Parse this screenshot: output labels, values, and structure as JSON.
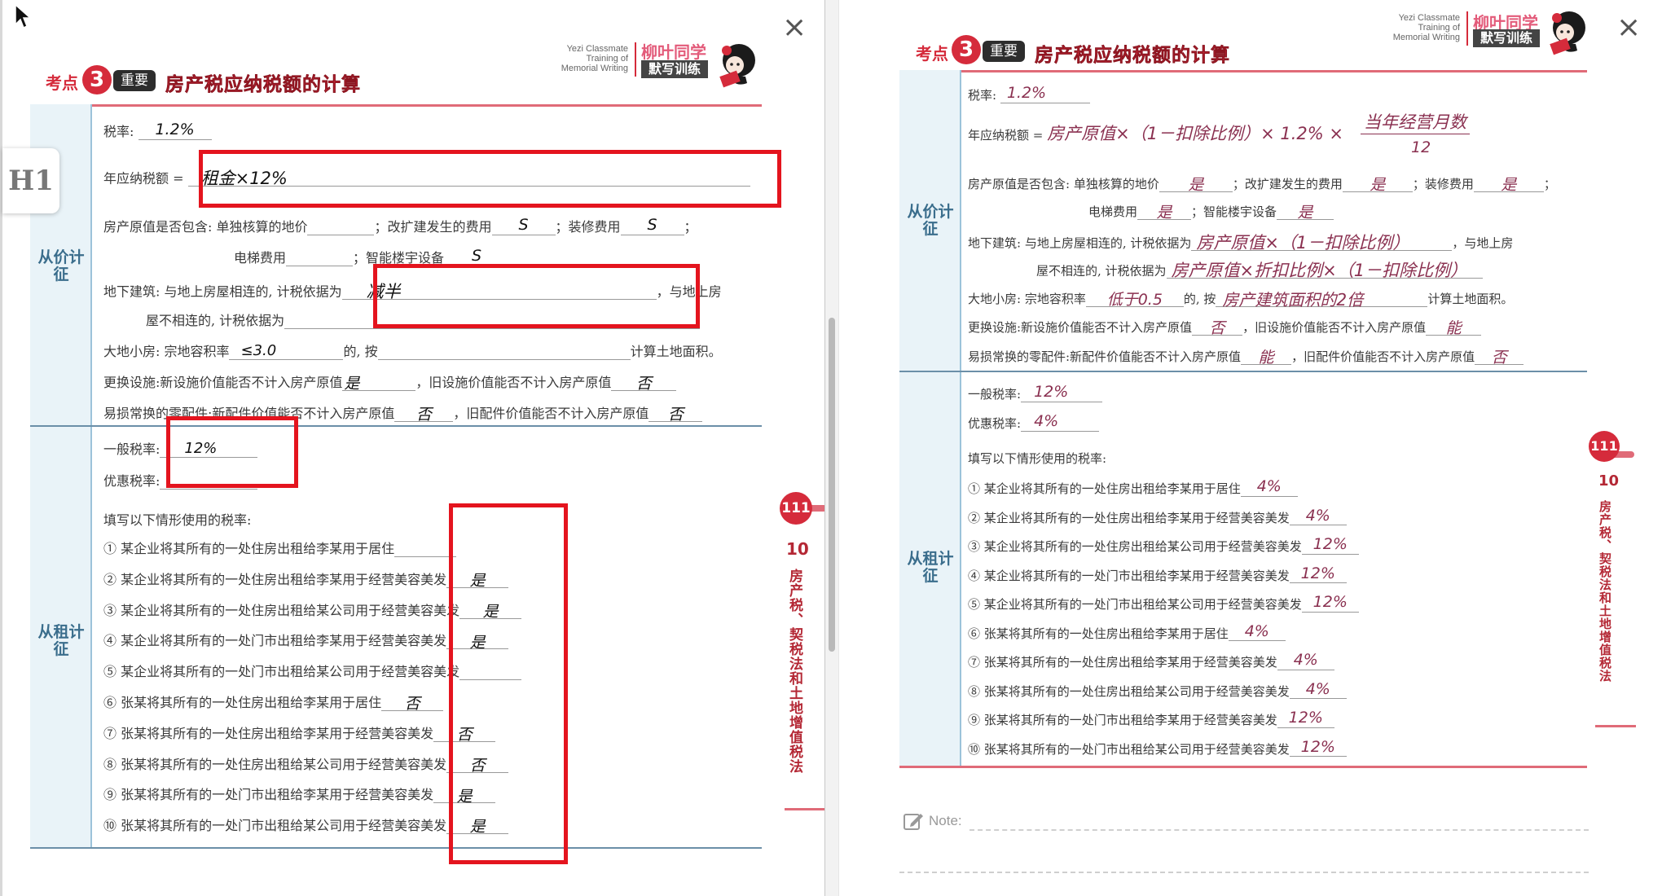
{
  "ui": {
    "close_glyph": "×",
    "h1_label": "H1",
    "note_label": "Note:"
  },
  "colors": {
    "accent_red": "#d52b3b",
    "annotation_box": "#e4141e",
    "sidebar_blue": "#e9f3f8"
  },
  "header": {
    "kaodian": "考点",
    "number": "3",
    "badge": "重要",
    "title": "房产税应纳税额的计算",
    "brand_en_1": "Yezi Classmate",
    "brand_en_2": "Training of",
    "brand_en_3": "Memorial Writing",
    "brand_zh": "柳叶同学",
    "brand_tag": "默写训练"
  },
  "side": {
    "by_value": "从价计征",
    "by_rent": "从租计征",
    "page_no": "111",
    "chapter_no": "10",
    "chapter_title": "房产税、契税法和土地增值税法"
  },
  "labels": {
    "rate": "税率:",
    "annual_tax": "年应纳税额 =",
    "orig_include": "房产原值是否包含: 单独核算的地价",
    "reno_cost": "；改扩建发生的费用",
    "deco_cost": "；装修费用",
    "elevator": "电梯费用",
    "smart": "；智能楼宇设备",
    "semicolon": "；",
    "underground": "地下建筑: 与地上房屋相连的, 计税依据为",
    "underground_2": "，与地上房",
    "underground_3": "屋不相连的, 计税依据为",
    "smallplot": "大地小房: 宗地容积率",
    "smallplot_2": "的, 按",
    "smallplot_3": "计算土地面积。",
    "replace": "更换设施:新设施价值能否不计入房产原值",
    "replace_2": "，旧设施价值能否不计入房产原值",
    "consumable": "易损常换的零配件:新配件价值能否不计入房产原值",
    "consumable_2": "，旧配件价值能否不计入房产原值",
    "general_rate": "一般税率:",
    "pref_rate": "优惠税率:",
    "fill_prompt": "填写以下情形使用的税率:",
    "cases": [
      "① 某企业将其所有的一处住房出租给李某用于居住",
      "② 某企业将其所有的一处住房出租给李某用于经营美容美发",
      "③ 某企业将其所有的一处住房出租给某公司用于经营美容美发",
      "④ 某企业将其所有的一处门市出租给李某用于经营美容美发",
      "⑤ 某企业将其所有的一处门市出租给某公司用于经营美容美发",
      "⑥ 张某将其所有的一处住房出租给李某用于居住",
      "⑦ 张某将其所有的一处住房出租给李某用于经营美容美发",
      "⑧ 张某将其所有的一处住房出租给某公司用于经营美容美发",
      "⑨ 张某将其所有的一处门市出租给李某用于经营美容美发",
      "⑩ 张某将其所有的一处门市出租给某公司用于经营美容美发"
    ]
  },
  "left_answers": {
    "rate": "1.2%",
    "annual_tax": "租金×12%",
    "land": "",
    "reno": "S",
    "deco": "S",
    "elevator": "",
    "smart": "S",
    "underground_conn": "减半",
    "underground_sep": "",
    "plot_ratio": "≤3.0",
    "plot_basis": "",
    "replace_new": "是",
    "replace_old": "否",
    "cons_new": "否",
    "cons_old": "否",
    "general_rate": "12%",
    "pref_rate": "",
    "cases": [
      "",
      "是",
      "是",
      "是",
      "",
      "否",
      "否",
      "否",
      "是",
      "是"
    ]
  },
  "right_answers": {
    "rate": "1.2%",
    "formula_a": "房产原值×（1－扣除比例）× 1.2% ×",
    "formula_num": "当年经营月数",
    "formula_den": "12",
    "land": "是",
    "reno": "是",
    "deco": "是",
    "elevator": "是",
    "smart": "是",
    "underground_conn": "房产原值×（1－扣除比例）",
    "underground_sep": "房产原值×折扣比例×（1－扣除比例）",
    "plot_ratio": "低于0.5",
    "plot_basis": "房产建筑面积的2倍",
    "replace_new": "否",
    "replace_old": "能",
    "cons_new": "能",
    "cons_old": "否",
    "general_rate": "12%",
    "pref_rate": "4%",
    "cases": [
      "4%",
      "4%",
      "12%",
      "12%",
      "12%",
      "4%",
      "4%",
      "4%",
      "12%",
      "12%"
    ]
  }
}
